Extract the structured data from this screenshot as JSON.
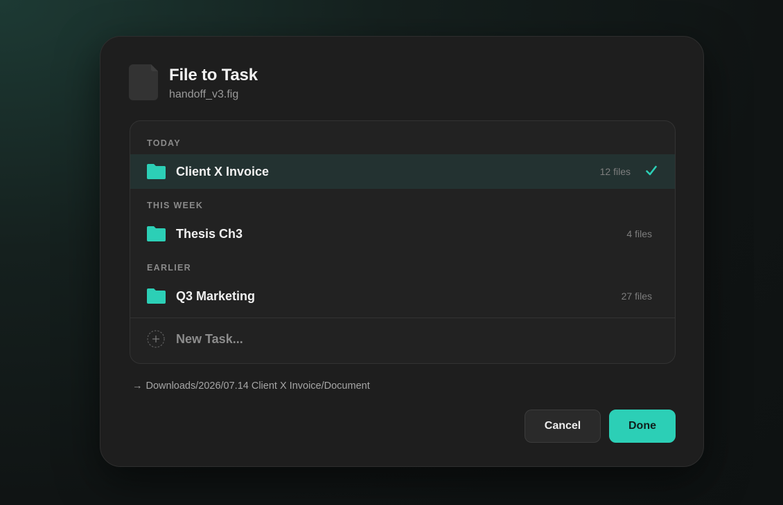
{
  "dialog": {
    "title": "File to Task",
    "filename": "handoff_v3.fig"
  },
  "sections": [
    {
      "label": "TODAY",
      "items": [
        {
          "name": "Client X Invoice",
          "count": "12 files",
          "selected": true
        }
      ]
    },
    {
      "label": "THIS WEEK",
      "items": [
        {
          "name": "Thesis Ch3",
          "count": "4 files",
          "selected": false
        }
      ]
    },
    {
      "label": "EARLIER",
      "items": [
        {
          "name": "Q3 Marketing",
          "count": "27 files",
          "selected": false
        }
      ]
    }
  ],
  "new_task": {
    "label": "New Task..."
  },
  "destination": {
    "arrow": "→",
    "path": "Downloads/2026/07.14 Client X Invoice/Document"
  },
  "buttons": {
    "cancel": "Cancel",
    "done": "Done"
  },
  "colors": {
    "accent": "#2ccfb6",
    "selected_row": "#233231",
    "dialog_bg": "#1e1e1e"
  },
  "icons": {
    "file": "document-icon",
    "folder": "folder-icon",
    "check": "checkmark-icon",
    "new": "plus-circle-icon",
    "arrow": "arrow-right-icon"
  }
}
